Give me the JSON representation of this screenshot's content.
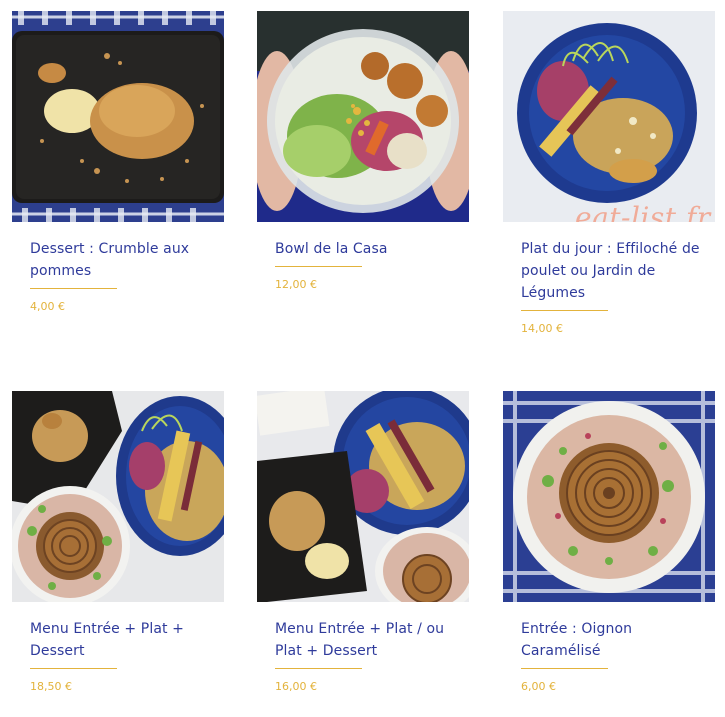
{
  "items": [
    {
      "title": "Dessert : Crumble aux pommes",
      "price": "4,00 €",
      "photo": "crumble-photo"
    },
    {
      "title": "Bowl de la Casa",
      "price": "12,00 €",
      "photo": "bowl-salad-photo"
    },
    {
      "title": "Plat du jour : Effiloché de poulet ou Jardin de Légumes",
      "price": "14,00 €",
      "photo": "plat-du-jour-photo"
    },
    {
      "title": "Menu Entrée + Plat + Dessert",
      "price": "18,50 €",
      "photo": "menu-trio-photo"
    },
    {
      "title": "Menu Entrée + Plat / ou Plat + Dessert",
      "price": "16,00 €",
      "photo": "menu-duo-photo"
    },
    {
      "title": "Entrée : Oignon Caramélisé",
      "price": "6,00 €",
      "photo": "oignon-photo"
    }
  ],
  "watermark": "eat-list.fr",
  "colors": {
    "title": "#2f3b9b",
    "price": "#e3b33c",
    "underline": "#e3b33c",
    "watermark": "#f1a48f"
  }
}
